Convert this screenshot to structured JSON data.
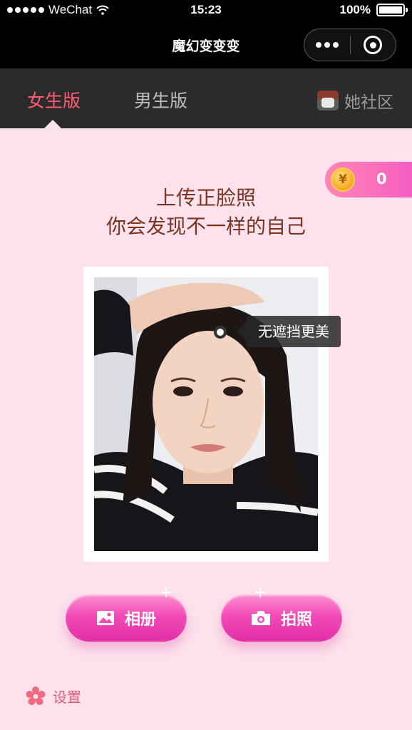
{
  "status_bar": {
    "carrier": "WeChat",
    "time": "15:23",
    "battery": "100%"
  },
  "title_bar": {
    "title": "魔幻变变变"
  },
  "tabs": [
    {
      "label": "女生版",
      "active": true
    },
    {
      "label": "男生版",
      "active": false
    }
  ],
  "community": {
    "label": "她社区"
  },
  "coin": {
    "symbol": "¥",
    "count": "0"
  },
  "headline": {
    "line1": "上传正脸照",
    "line2": "你会发现不一样的自己"
  },
  "photo_tip": "无遮挡更美",
  "buttons": {
    "album": "相册",
    "camera": "拍照"
  },
  "settings": {
    "label": "设置"
  },
  "colors": {
    "background": "#fde1ec",
    "accent": "#ff5a6e",
    "button": "#f24bb8",
    "headline": "#7a3520"
  }
}
